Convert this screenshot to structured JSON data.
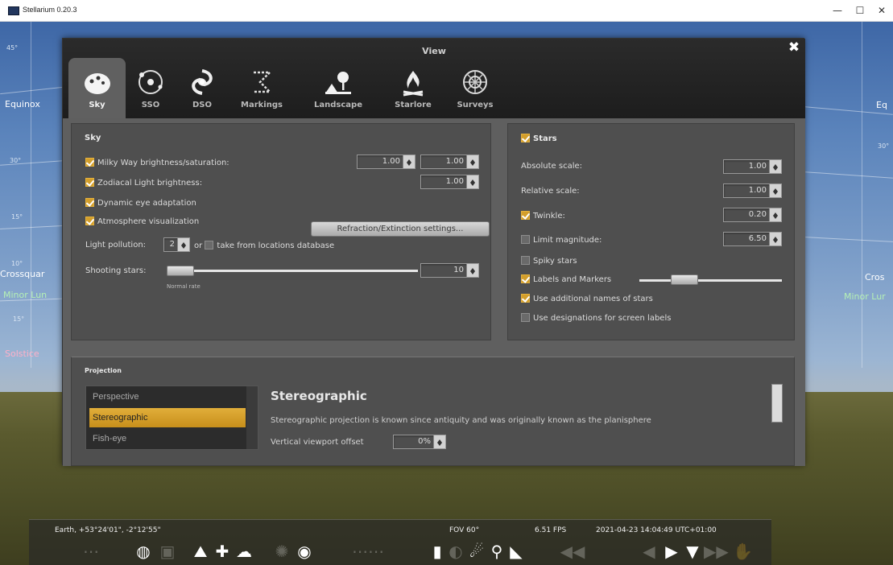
{
  "window": {
    "title": "Stellarium 0.20.3"
  },
  "sky_labels": {
    "equinox_left": "Equinox",
    "equinox_right": "Eq",
    "crossquarter_left": "Crossquar",
    "crossquarter_right": "Cros",
    "minor_lunar_left": "Minor Lun",
    "minor_lunar_right": "Minor Lur",
    "solstice_left": "Solstice",
    "deg_marks": [
      "45°",
      "30°",
      "15°",
      "10°",
      "15°",
      "30°"
    ]
  },
  "dialog": {
    "title": "View",
    "tabs": [
      {
        "label": "Sky",
        "icon": "sky-icon"
      },
      {
        "label": "SSO",
        "icon": "sso-icon"
      },
      {
        "label": "DSO",
        "icon": "dso-icon"
      },
      {
        "label": "Markings",
        "icon": "markings-icon"
      },
      {
        "label": "Landscape",
        "icon": "landscape-icon"
      },
      {
        "label": "Starlore",
        "icon": "starlore-icon"
      },
      {
        "label": "Surveys",
        "icon": "surveys-icon"
      }
    ],
    "active_tab": "Sky"
  },
  "sky_group": {
    "title": "Sky",
    "milky_way": {
      "label": "Milky Way brightness/saturation:",
      "checked": true,
      "brightness": "1.00",
      "saturation": "1.00"
    },
    "zodiacal": {
      "label": "Zodiacal Light brightness:",
      "checked": true,
      "value": "1.00"
    },
    "dynamic_eye": {
      "label": "Dynamic eye adaptation",
      "checked": true
    },
    "atmosphere": {
      "label": "Atmosphere visualization",
      "checked": true
    },
    "refraction_button": "Refraction/Extinction settings...",
    "light_pollution": {
      "label": "Light pollution:",
      "value": "2",
      "or_text": "or",
      "from_db_label": "take from locations database",
      "from_db_checked": false
    },
    "shooting_stars": {
      "label": "Shooting stars:",
      "value": "10",
      "rate_caption": "Normal rate",
      "slider_fraction": 0.0
    }
  },
  "stars_group": {
    "title": "Stars",
    "checked": true,
    "absolute_scale": {
      "label": "Absolute scale:",
      "value": "1.00"
    },
    "relative_scale": {
      "label": "Relative scale:",
      "value": "1.00"
    },
    "twinkle": {
      "label": "Twinkle:",
      "checked": true,
      "value": "0.20"
    },
    "limit_magnitude": {
      "label": "Limit magnitude:",
      "checked": false,
      "value": "6.50"
    },
    "spiky_stars": {
      "label": "Spiky stars",
      "checked": false
    },
    "labels_markers": {
      "label": "Labels and Markers",
      "checked": true,
      "slider_fraction": 0.28
    },
    "additional_names": {
      "label": "Use additional names of stars",
      "checked": true
    },
    "designations": {
      "label": "Use designations for screen labels",
      "checked": false
    }
  },
  "projection": {
    "title": "Projection",
    "items": [
      "Perspective",
      "Stereographic",
      "Fish-eye"
    ],
    "selected": "Stereographic",
    "desc_title": "Stereographic",
    "desc_text": "Stereographic projection is known since antiquity and was originally known as the planisphere",
    "viewport_label": "Vertical viewport offset",
    "viewport_value": "0%"
  },
  "status_bar": {
    "location": "Earth, +53°24'01\", -2°12'55\"",
    "fov": "FOV 60°",
    "fps": "6.51 FPS",
    "datetime": "2021-04-23 14:04:49 UTC+01:00"
  },
  "toolbar_icons": [
    "constellation-lines-icon",
    "equatorial-grid-icon",
    "azimuthal-grid-icon",
    "ground-icon",
    "cardinal-points-icon",
    "atmosphere-icon",
    "nebulae-icon",
    "planets-icon",
    "satellites-icon",
    "bookmark-icon",
    "search-icon",
    "night-mode-icon",
    "play-icon",
    "time-icon",
    "exoplanets-icon",
    "fullscreen-icon"
  ]
}
